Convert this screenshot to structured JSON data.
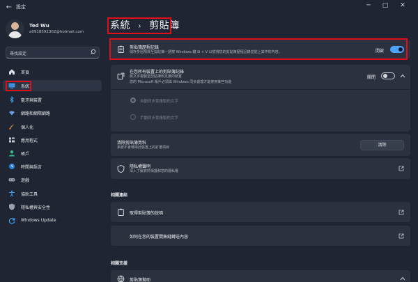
{
  "window": {
    "title": "設定",
    "back_icon": "arrow-left-icon",
    "controls": [
      "minimize-icon",
      "maximize-icon",
      "close-icon"
    ]
  },
  "user": {
    "name": "Ted Wu",
    "email": "a0918592302@hotmail.com"
  },
  "search": {
    "placeholder": "尋找設定",
    "icon": "search-icon"
  },
  "sidebar": {
    "active_index": 1,
    "accent": "#4da3ff",
    "items": [
      {
        "label": "首頁",
        "icon": "home-icon"
      },
      {
        "label": "系統",
        "icon": "display-icon"
      },
      {
        "label": "藍牙與裝置",
        "icon": "bluetooth-icon"
      },
      {
        "label": "網路和網際網路",
        "icon": "wifi-icon"
      },
      {
        "label": "個人化",
        "icon": "brush-icon"
      },
      {
        "label": "應用程式",
        "icon": "apps-icon"
      },
      {
        "label": "帳戶",
        "icon": "person-icon"
      },
      {
        "label": "時間與語言",
        "icon": "globe-clock-icon"
      },
      {
        "label": "遊戲",
        "icon": "gamepad-icon"
      },
      {
        "label": "協助工具",
        "icon": "accessibility-icon"
      },
      {
        "label": "隱私權與安全性",
        "icon": "shield-icon"
      },
      {
        "label": "Windows Update",
        "icon": "update-icon"
      }
    ]
  },
  "breadcrumb": {
    "parent": "系統",
    "separator": "›",
    "current": "剪貼簿"
  },
  "clipboard_history": {
    "title": "剪貼簿歷程記錄",
    "description": "儲存多個項目至剪貼簿—請按 Windows 鍵 ⊞ + V 以檢視您的剪貼簿歷程記錄並貼上其中的內容。",
    "toggle_label": "開啟",
    "toggle_on": true,
    "icon": "clipboard-icon"
  },
  "sync": {
    "title": "在您所有裝置上的剪貼簿記錄",
    "description_line1": "將文字複製至剪貼簿到支援的裝置",
    "description_line2": "您的 Microsoft 帳戶必須與 Windows 同步處理才能使用某些功能",
    "toggle_label": "關閉",
    "toggle_on": false,
    "icon": "sync-clipboard-icon",
    "expand_icon": "chevron-up-icon",
    "options": [
      {
        "label": "自動同步我複製的文字",
        "checked": true
      },
      {
        "label": "手動同步我複製的文字",
        "checked": false
      }
    ]
  },
  "clear_data": {
    "title": "清除剪貼簿資料",
    "description": "系統不會移除此裝置上的釘選項目",
    "button_label": "清除"
  },
  "privacy": {
    "title": "隱私權聲明",
    "description": "深入了解資料保護和您的隱私權",
    "icon": "shield-icon",
    "link_icon": "external-link-icon"
  },
  "related_links": {
    "heading": "相關連結",
    "items": [
      {
        "label": "取得剪貼簿的說明",
        "icon": "clipboard-icon"
      },
      {
        "label": "如何在您的裝置間無縫轉送內容",
        "icon": "devices-icon"
      }
    ]
  },
  "related_support": {
    "heading": "相關支援",
    "items": [
      {
        "label": "剪貼簿幫助",
        "icon": "globe-icon"
      }
    ]
  }
}
